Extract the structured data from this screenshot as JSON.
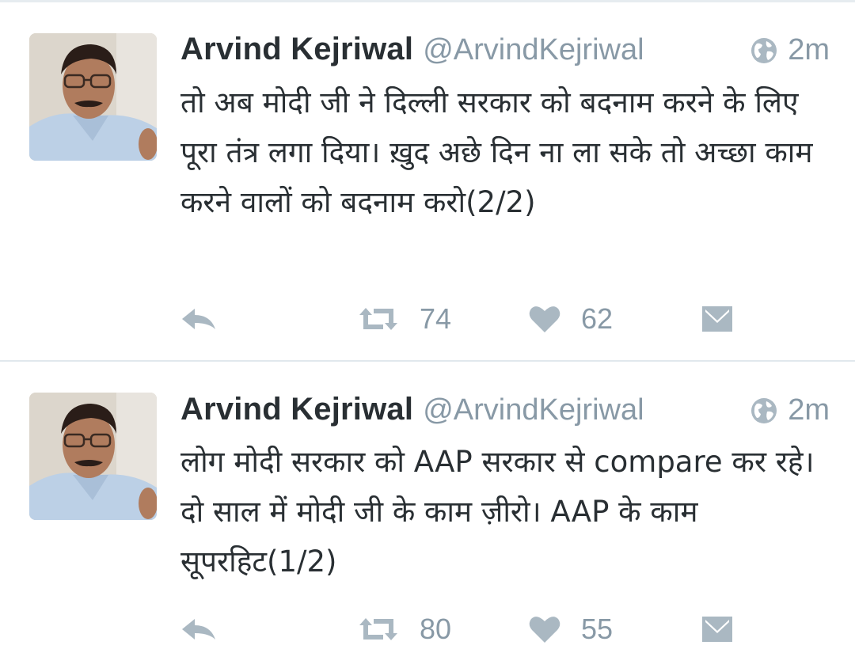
{
  "colors": {
    "text": "#292f33",
    "muted": "#8899a6",
    "icon": "#aab8c2",
    "divider": "#e1e8ed"
  },
  "tweets": [
    {
      "name": "Arvind Kejriwal",
      "handle": "@ArvindKejriwal",
      "time": "2m",
      "text": "तो अब मोदी जी ने दिल्ली सरकार को बदनाम करने के लिए पूरा तंत्र लगा दिया। ख़ुद अछे दिन ना ला सके तो अच्छा काम करने वालों को बदनाम करो(2/2)",
      "retweets": "74",
      "likes": "62"
    },
    {
      "name": "Arvind Kejriwal",
      "handle": "@ArvindKejriwal",
      "time": "2m",
      "text": "लोग मोदी सरकार को AAP सरकार से compare कर रहे। दो साल में मोदी जी के काम ज़ीरो। AAP के काम सूपरहिट(1/2)",
      "retweets": "80",
      "likes": "55"
    }
  ],
  "icons": {
    "timestamp": "globe-icon",
    "reply": "reply-icon",
    "retweet": "retweet-icon",
    "like": "heart-icon",
    "message": "envelope-icon"
  }
}
